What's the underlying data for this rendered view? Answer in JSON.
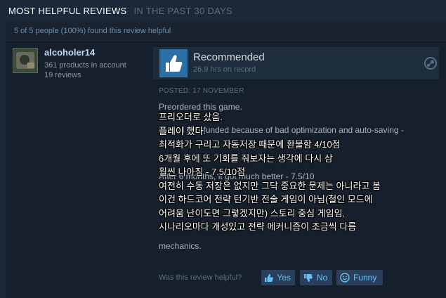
{
  "header": {
    "title": "MOST HELPFUL REVIEWS",
    "subtitle": "IN THE PAST 30 DAYS"
  },
  "review": {
    "helpful_summary": "5 of 5 people (100%) found this review helpful",
    "author": {
      "name": "alcoholer14",
      "products": "361 products in account",
      "reviews": "19 reviews"
    },
    "verdict": "Recommended",
    "hours": "26.9 hrs on record",
    "posted": "POSTED: 17 NOVEMBER",
    "body_lines": [
      "Preordered this game.",
      "",
      "Played it, refunded because of bad optimization and auto-saving -",
      "",
      "",
      "",
      "After 6 months, it got much better - 7.5/10",
      "",
      "",
      "",
      "",
      "",
      "mechanics."
    ],
    "overlay_lines": [
      "프리오더로 샀음.",
      "플레이 했다.",
      "최적화가 구리고    자동저장 때문에     환불함 4/10점",
      "6개월 후에 또 기회를 줘보자는 생각에 다시 삼",
      "훨씬 나아짐 - 7.5/10점",
      "여전히 수동 저장은 없지만 그닥 중요한 문제는 아니라고 봄",
      "이건 하드코어 전략 턴기반 전술 게임이 아님(철인 모드에",
      "어려움 난이도면 그렇겠지만) 스토리 중심 게임임.",
      "시나리오마다 개성있고 전략 메커니즘이 조금씩 다름"
    ],
    "helpful_prompt": "Was this review helpful?",
    "buttons": {
      "yes": "Yes",
      "no": "No",
      "funny": "Funny"
    }
  },
  "colors": {
    "background": "#1b2838",
    "link": "#67c1f5",
    "thumb": "#2c6fa6"
  }
}
